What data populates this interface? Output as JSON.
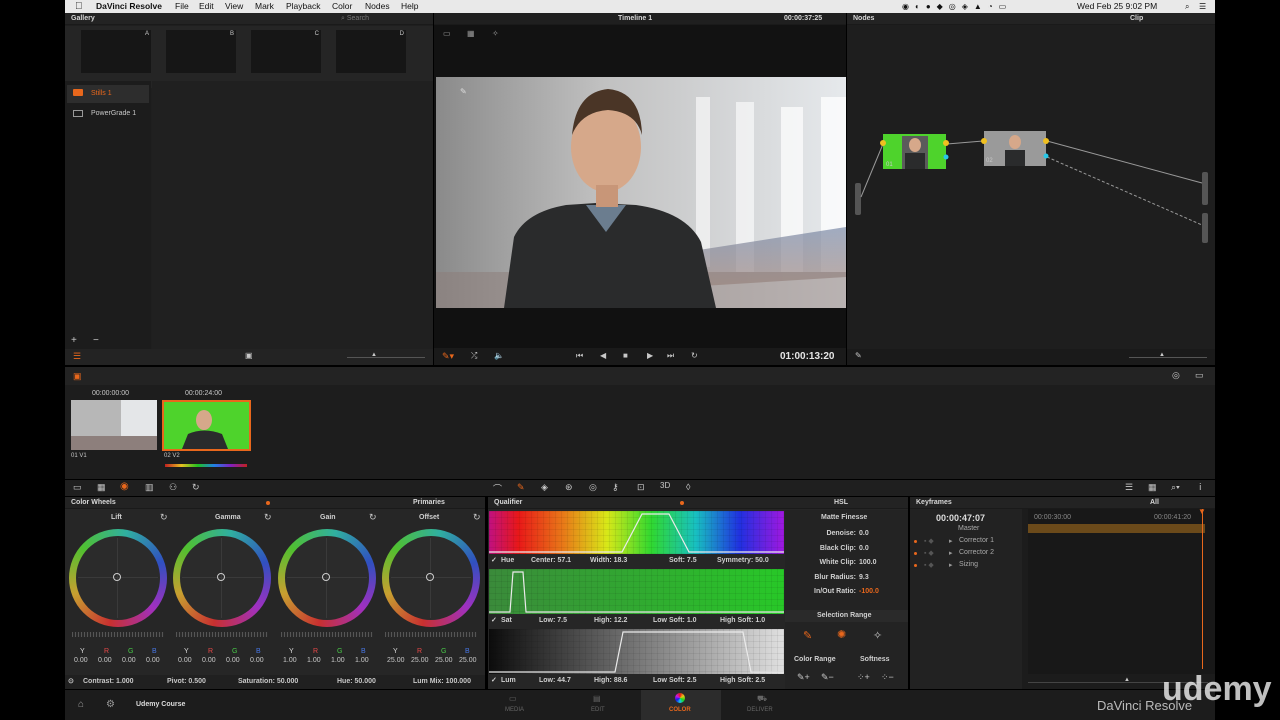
{
  "menubar": {
    "app_name": "DaVinci Resolve",
    "menus": [
      "File",
      "Edit",
      "View",
      "Mark",
      "Playback",
      "Color",
      "Nodes",
      "Help"
    ],
    "clock": "Wed Feb 25  9:02 PM"
  },
  "gallery": {
    "title": "Gallery",
    "search_placeholder": "Search",
    "still_labels": [
      "A",
      "B",
      "C",
      "D"
    ],
    "albums": [
      "Stills 1",
      "PowerGrade 1"
    ]
  },
  "viewer": {
    "timeline_name": "Timeline 1",
    "timecode_top": "00:00:37:25",
    "timecode_bottom": "01:00:13:20"
  },
  "nodes": {
    "title": "Nodes",
    "mode": "Clip",
    "node_labels": [
      "01",
      "02"
    ]
  },
  "clips": [
    {
      "timecode": "00:00:00:00",
      "index": "01",
      "track": "V1"
    },
    {
      "timecode": "00:00:24:00",
      "index": "02",
      "track": "V2"
    }
  ],
  "color_wheels": {
    "title": "Color Wheels",
    "mode": "Primaries",
    "wheels": [
      {
        "name": "Lift",
        "values": [
          "0.00",
          "0.00",
          "0.00",
          "0.00"
        ]
      },
      {
        "name": "Gamma",
        "values": [
          "0.00",
          "0.00",
          "0.00",
          "0.00"
        ]
      },
      {
        "name": "Gain",
        "values": [
          "1.00",
          "1.00",
          "1.00",
          "1.00"
        ]
      },
      {
        "name": "Offset",
        "values": [
          "25.00",
          "25.00",
          "25.00",
          "25.00"
        ]
      }
    ],
    "channel_letters": [
      "Y",
      "R",
      "G",
      "B"
    ],
    "footer": {
      "contrast": "Contrast: 1.000",
      "pivot": "Pivot: 0.500",
      "saturation": "Saturation: 50.000",
      "hue": "Hue: 50.000",
      "lum_mix": "Lum Mix: 100.000"
    }
  },
  "qualifier": {
    "title": "Qualifier",
    "mode": "HSL",
    "hue_row": {
      "label": "Hue",
      "center": "Center: 57.1",
      "width": "Width: 18.3",
      "soft": "Soft: 7.5",
      "symmetry": "Symmetry: 50.0"
    },
    "sat_row": {
      "label": "Sat",
      "low": "Low: 7.5",
      "high": "High: 12.2",
      "low_soft": "Low Soft: 1.0",
      "high_soft": "High Soft: 1.0"
    },
    "lum_row": {
      "label": "Lum",
      "low": "Low: 44.7",
      "high": "High: 88.6",
      "low_soft": "Low Soft: 2.5",
      "high_soft": "High Soft: 2.5"
    }
  },
  "matte_finesse": {
    "title": "Matte Finesse",
    "rows": [
      {
        "label": "Denoise:",
        "value": "0.0"
      },
      {
        "label": "Black Clip:",
        "value": "0.0"
      },
      {
        "label": "White Clip:",
        "value": "100.0"
      },
      {
        "label": "Blur Radius:",
        "value": "9.3"
      },
      {
        "label": "In/Out Ratio:",
        "value": "-100.0"
      }
    ],
    "selection_range": "Selection Range",
    "color_range": "Color Range",
    "softness": "Softness"
  },
  "keyframes": {
    "title": "Keyframes",
    "filter": "All",
    "timecode": "00:00:47:07",
    "ruler_start": "00:00:30:00",
    "ruler_end": "00:00:41:20",
    "tracks": [
      "Master",
      "Corrector 1",
      "Corrector 2",
      "Sizing"
    ]
  },
  "bottom_bar": {
    "project_name": "Udemy Course",
    "pages": [
      "MEDIA",
      "EDIT",
      "COLOR",
      "DELIVER"
    ],
    "active_page": "COLOR",
    "brand": "DaVinci Resolve",
    "watermark": "udemy"
  },
  "colors": {
    "accent_orange": "#e8671c",
    "green_screen": "#4ed32c",
    "panel_bg": "#282828"
  }
}
